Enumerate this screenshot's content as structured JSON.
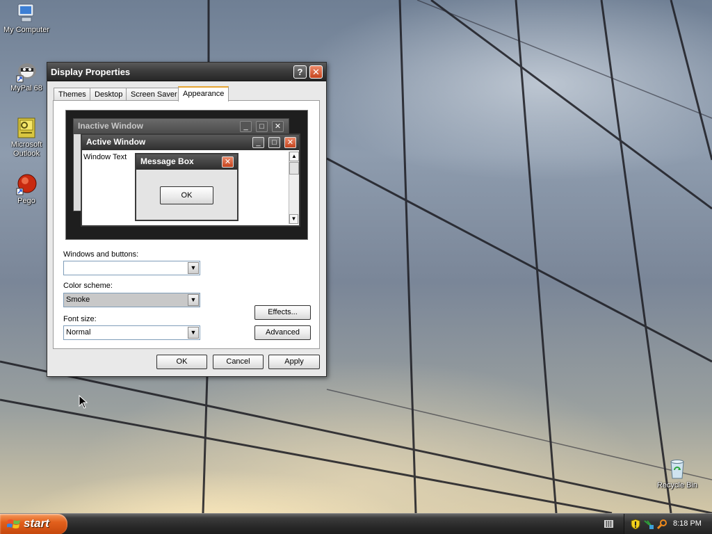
{
  "desktop": {
    "icons": [
      {
        "label": "My Computer",
        "icon": "my-computer-icon"
      },
      {
        "label": "MyPal 68",
        "icon": "mypal-browser-icon"
      },
      {
        "label": "Microsoft Outlook",
        "label_line1": "Microsoft",
        "label_line2": "Outlook",
        "icon": "outlook-icon"
      },
      {
        "label": "Pego",
        "icon": "pego-icon"
      },
      {
        "label": "Recycle Bin",
        "icon": "recycle-bin-icon"
      }
    ]
  },
  "window": {
    "title": "Display Properties",
    "help_glyph": "?",
    "close_glyph": "✕",
    "tabs": [
      {
        "label": "Themes",
        "active": false
      },
      {
        "label": "Desktop",
        "active": false
      },
      {
        "label": "Screen Saver",
        "active": false
      },
      {
        "label": "Appearance",
        "active": true
      }
    ],
    "preview": {
      "inactive_title": "Inactive Window",
      "active_title": "Active Window",
      "window_text": "Window Text",
      "message_title": "Message Box",
      "message_ok": "OK"
    },
    "windows_buttons": {
      "label": "Windows and buttons:",
      "value": ""
    },
    "color_scheme": {
      "label": "Color scheme:",
      "value": "Smoke"
    },
    "font_size": {
      "label": "Font size:",
      "value": "Normal"
    },
    "effects_label": "Effects...",
    "advanced_label": "Advanced",
    "ok_label": "OK",
    "cancel_label": "Cancel",
    "apply_label": "Apply"
  },
  "taskbar": {
    "start_label": "start",
    "clock": "8:18 PM"
  },
  "colors": {
    "title_bar": "#3d3d3d",
    "close_button": "#c5431d",
    "start_button": "#e2601c",
    "active_tab_accent": "#e6a431"
  }
}
